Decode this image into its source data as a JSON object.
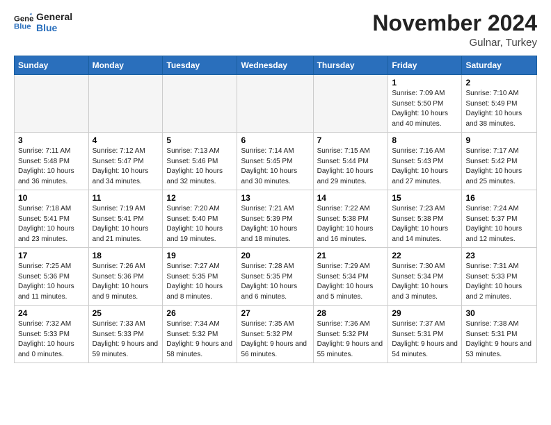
{
  "header": {
    "logo_line1": "General",
    "logo_line2": "Blue",
    "month": "November 2024",
    "location": "Gulnar, Turkey"
  },
  "days_of_week": [
    "Sunday",
    "Monday",
    "Tuesday",
    "Wednesday",
    "Thursday",
    "Friday",
    "Saturday"
  ],
  "weeks": [
    [
      {
        "day": "",
        "info": ""
      },
      {
        "day": "",
        "info": ""
      },
      {
        "day": "",
        "info": ""
      },
      {
        "day": "",
        "info": ""
      },
      {
        "day": "",
        "info": ""
      },
      {
        "day": "1",
        "info": "Sunrise: 7:09 AM\nSunset: 5:50 PM\nDaylight: 10 hours and 40 minutes."
      },
      {
        "day": "2",
        "info": "Sunrise: 7:10 AM\nSunset: 5:49 PM\nDaylight: 10 hours and 38 minutes."
      }
    ],
    [
      {
        "day": "3",
        "info": "Sunrise: 7:11 AM\nSunset: 5:48 PM\nDaylight: 10 hours and 36 minutes."
      },
      {
        "day": "4",
        "info": "Sunrise: 7:12 AM\nSunset: 5:47 PM\nDaylight: 10 hours and 34 minutes."
      },
      {
        "day": "5",
        "info": "Sunrise: 7:13 AM\nSunset: 5:46 PM\nDaylight: 10 hours and 32 minutes."
      },
      {
        "day": "6",
        "info": "Sunrise: 7:14 AM\nSunset: 5:45 PM\nDaylight: 10 hours and 30 minutes."
      },
      {
        "day": "7",
        "info": "Sunrise: 7:15 AM\nSunset: 5:44 PM\nDaylight: 10 hours and 29 minutes."
      },
      {
        "day": "8",
        "info": "Sunrise: 7:16 AM\nSunset: 5:43 PM\nDaylight: 10 hours and 27 minutes."
      },
      {
        "day": "9",
        "info": "Sunrise: 7:17 AM\nSunset: 5:42 PM\nDaylight: 10 hours and 25 minutes."
      }
    ],
    [
      {
        "day": "10",
        "info": "Sunrise: 7:18 AM\nSunset: 5:41 PM\nDaylight: 10 hours and 23 minutes."
      },
      {
        "day": "11",
        "info": "Sunrise: 7:19 AM\nSunset: 5:41 PM\nDaylight: 10 hours and 21 minutes."
      },
      {
        "day": "12",
        "info": "Sunrise: 7:20 AM\nSunset: 5:40 PM\nDaylight: 10 hours and 19 minutes."
      },
      {
        "day": "13",
        "info": "Sunrise: 7:21 AM\nSunset: 5:39 PM\nDaylight: 10 hours and 18 minutes."
      },
      {
        "day": "14",
        "info": "Sunrise: 7:22 AM\nSunset: 5:38 PM\nDaylight: 10 hours and 16 minutes."
      },
      {
        "day": "15",
        "info": "Sunrise: 7:23 AM\nSunset: 5:38 PM\nDaylight: 10 hours and 14 minutes."
      },
      {
        "day": "16",
        "info": "Sunrise: 7:24 AM\nSunset: 5:37 PM\nDaylight: 10 hours and 12 minutes."
      }
    ],
    [
      {
        "day": "17",
        "info": "Sunrise: 7:25 AM\nSunset: 5:36 PM\nDaylight: 10 hours and 11 minutes."
      },
      {
        "day": "18",
        "info": "Sunrise: 7:26 AM\nSunset: 5:36 PM\nDaylight: 10 hours and 9 minutes."
      },
      {
        "day": "19",
        "info": "Sunrise: 7:27 AM\nSunset: 5:35 PM\nDaylight: 10 hours and 8 minutes."
      },
      {
        "day": "20",
        "info": "Sunrise: 7:28 AM\nSunset: 5:35 PM\nDaylight: 10 hours and 6 minutes."
      },
      {
        "day": "21",
        "info": "Sunrise: 7:29 AM\nSunset: 5:34 PM\nDaylight: 10 hours and 5 minutes."
      },
      {
        "day": "22",
        "info": "Sunrise: 7:30 AM\nSunset: 5:34 PM\nDaylight: 10 hours and 3 minutes."
      },
      {
        "day": "23",
        "info": "Sunrise: 7:31 AM\nSunset: 5:33 PM\nDaylight: 10 hours and 2 minutes."
      }
    ],
    [
      {
        "day": "24",
        "info": "Sunrise: 7:32 AM\nSunset: 5:33 PM\nDaylight: 10 hours and 0 minutes."
      },
      {
        "day": "25",
        "info": "Sunrise: 7:33 AM\nSunset: 5:33 PM\nDaylight: 9 hours and 59 minutes."
      },
      {
        "day": "26",
        "info": "Sunrise: 7:34 AM\nSunset: 5:32 PM\nDaylight: 9 hours and 58 minutes."
      },
      {
        "day": "27",
        "info": "Sunrise: 7:35 AM\nSunset: 5:32 PM\nDaylight: 9 hours and 56 minutes."
      },
      {
        "day": "28",
        "info": "Sunrise: 7:36 AM\nSunset: 5:32 PM\nDaylight: 9 hours and 55 minutes."
      },
      {
        "day": "29",
        "info": "Sunrise: 7:37 AM\nSunset: 5:31 PM\nDaylight: 9 hours and 54 minutes."
      },
      {
        "day": "30",
        "info": "Sunrise: 7:38 AM\nSunset: 5:31 PM\nDaylight: 9 hours and 53 minutes."
      }
    ]
  ]
}
